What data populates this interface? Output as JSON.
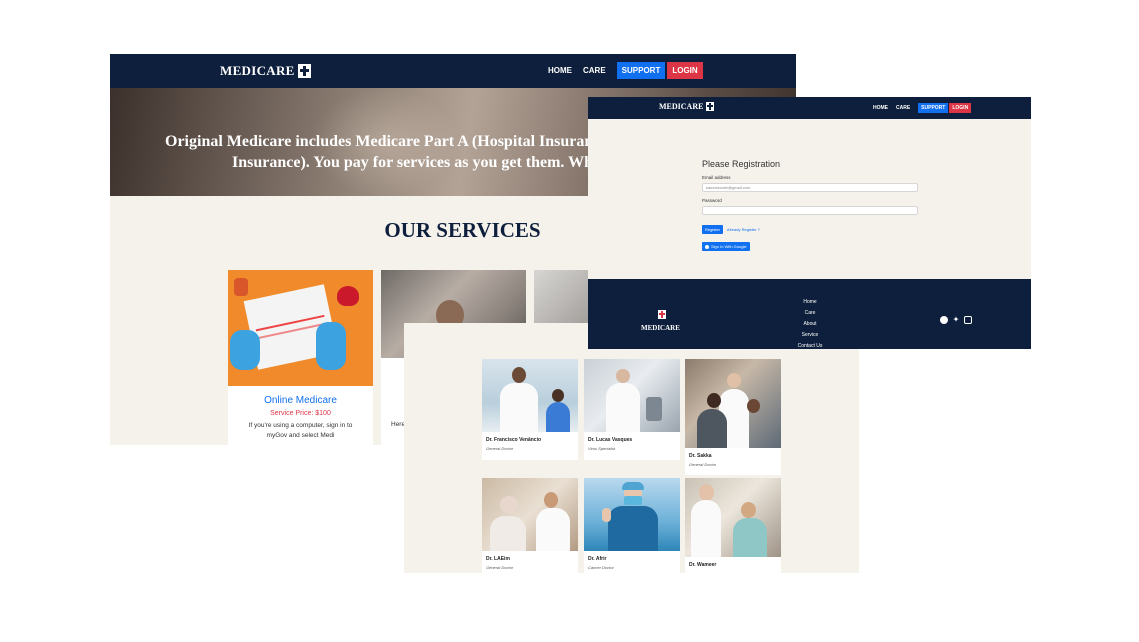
{
  "brand": {
    "name": "MEDICARE"
  },
  "nav": {
    "home": "HOME",
    "care": "CARE",
    "support": "SUPPORT",
    "login": "LOGIN"
  },
  "hero": {
    "line1": "Original Medicare includes Medicare Part A (Hospital Insurance) and",
    "line2": "Insurance). You pay for services as you get them. When yo"
  },
  "services": {
    "title": "OUR SERVICES",
    "cards": [
      {
        "name": "Online Medicare",
        "price": "Service Price: $100",
        "desc": "If you're using a computer, sign in to myGov and select Medi"
      },
      {
        "desc_fragment": "Here"
      }
    ]
  },
  "registration": {
    "title": "Please Registration",
    "email_label": "Email address",
    "email_value": "kamrulcoder@gmail.com",
    "password_label": "Password",
    "password_value": "",
    "register_button": "Register",
    "already_link": "Already Register ?",
    "google_button": "Sign In With Google"
  },
  "footer": {
    "brand": "MEDICARE",
    "links": [
      "Home",
      "Care",
      "About",
      "Service",
      "Contact Us"
    ],
    "social_icons": [
      "facebook-icon",
      "twitter-icon",
      "instagram-icon"
    ]
  },
  "doctors": [
    {
      "name": "Dr. Francisco Venâncio",
      "role": "General Doctor"
    },
    {
      "name": "Dr. Lucas Vasques",
      "role": "Virus Specialist"
    },
    {
      "name": "Dr. Sakka",
      "role": "General Doctor"
    },
    {
      "name": "Dr. LAEim",
      "role": "General Doctor"
    },
    {
      "name": "Dr. Afrir",
      "role": "Cancer Doctor"
    },
    {
      "name": "Dr. Wameer",
      "role": ""
    }
  ],
  "colors": {
    "navy": "#0d1f3c",
    "support_blue": "#1170f0",
    "login_red": "#dc3545",
    "page_bg": "#f5f1eb"
  }
}
